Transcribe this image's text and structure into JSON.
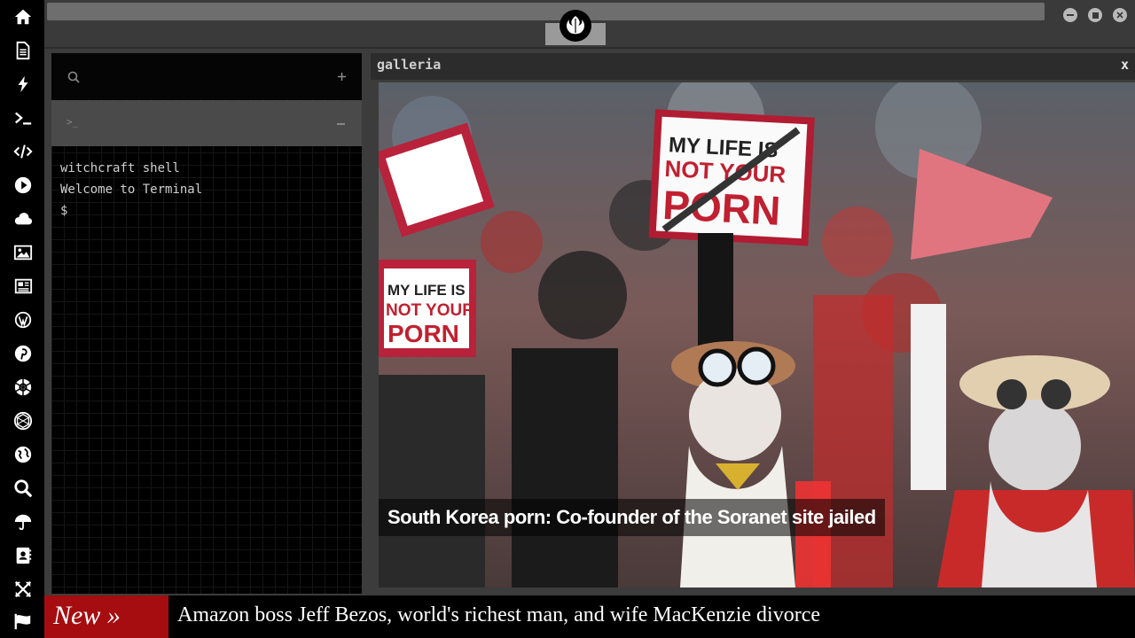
{
  "sidebar": {
    "icons": [
      "home-icon",
      "document-icon",
      "bolt-icon",
      "terminal-icon",
      "code-icon",
      "play-icon",
      "cloud-icon",
      "image-icon",
      "newspaper-icon",
      "wordpress-icon",
      "pinterest-icon",
      "rebel-alliance-icon",
      "galactic-empire-icon",
      "globe-icon",
      "search-icon",
      "umbrella-icon",
      "address-book-icon",
      "expand-icon",
      "flag-icon"
    ]
  },
  "terminal": {
    "search_icon": "search-icon",
    "add_icon": "plus-icon",
    "prompt_icon": ">_",
    "minimize_icon": "minus-icon",
    "lines": [
      "witchcraft shell",
      "Welcome to Terminal",
      "$"
    ]
  },
  "gallery": {
    "title": "galleria",
    "close": "x",
    "caption": "South Korea porn: Co-founder of the Soranet site jailed",
    "sign_text": [
      "MY LIFE IS",
      "NOT YOUR",
      "PORN"
    ]
  },
  "ticker": {
    "badge": "New »",
    "headline": "Amazon boss Jeff Bezos, world's richest man, and wife MacKenzie divorce"
  },
  "colors": {
    "ticker_badge": "#a50d10",
    "background": "#3c3c3c",
    "sidebar": "#000000"
  }
}
